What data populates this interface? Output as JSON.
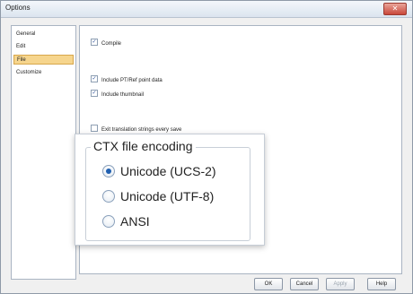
{
  "window": {
    "title": "Options",
    "close_glyph": "✕"
  },
  "sidebar": {
    "items": [
      {
        "label": "General"
      },
      {
        "label": "Edit"
      },
      {
        "label": "File",
        "selected": true
      },
      {
        "label": "Customize"
      }
    ]
  },
  "options": {
    "compile": {
      "label": "Compile",
      "checked": true
    },
    "include_pts": {
      "label": "Include PT/Ref point data",
      "checked": true
    },
    "include_thumbnail": {
      "label": "Include thumbnail",
      "checked": true
    },
    "exit_translation": {
      "label": "Exit translation strings every save",
      "checked": false
    }
  },
  "encoding": {
    "label": "CTX file encoding",
    "options": [
      {
        "label": "Unicode (UCS-2)",
        "selected": true
      },
      {
        "label": "Unicode (UTF-8)",
        "selected": false
      },
      {
        "label": "ANSI",
        "selected": false
      }
    ]
  },
  "buttons": {
    "ok": "OK",
    "cancel": "Cancel",
    "apply": "Apply",
    "help": "Help"
  },
  "checkmark_glyph": "✓",
  "colors": {
    "selected_bg": "#f6d58d",
    "radio_dot": "#1f5fb0"
  }
}
